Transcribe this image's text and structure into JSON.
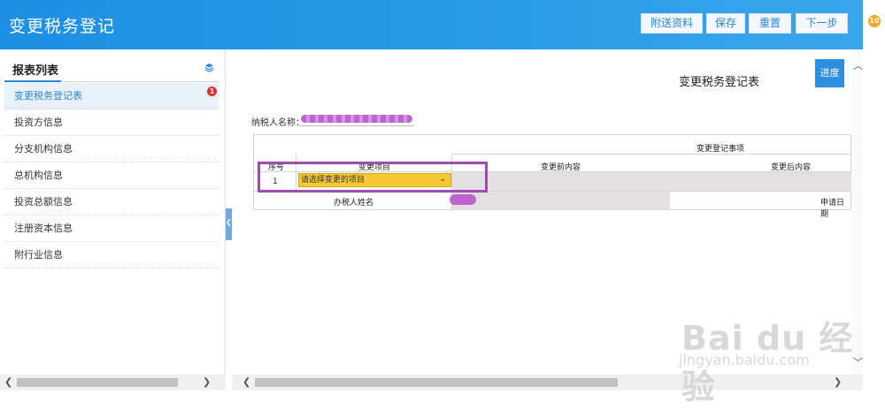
{
  "header": {
    "title": "变更税务登记",
    "buttons": {
      "attach": "附送资料",
      "save": "保存",
      "reset": "重置",
      "next": "下一步"
    },
    "notification_count": "10"
  },
  "sidebar": {
    "title": "报表列表",
    "items": [
      {
        "label": "变更税务登记表",
        "badge": "1"
      },
      {
        "label": "投资方信息"
      },
      {
        "label": "分支机构信息"
      },
      {
        "label": "总机构信息"
      },
      {
        "label": "投资总额信息"
      },
      {
        "label": "注册资本信息"
      },
      {
        "label": "附行业信息"
      }
    ]
  },
  "form": {
    "title": "变更税务登记表",
    "progress_label": "进度",
    "taxpayer_label": "纳税人名称：",
    "table": {
      "group_header": "变更登记事项",
      "col_seq": "序号",
      "col_item": "变更项目",
      "col_before": "变更前内容",
      "col_after": "变更后内容",
      "row_seq": "1",
      "select_value": "请选择变更的项目",
      "agent_label": "办税人姓名",
      "apply_date_label": "申请日期"
    }
  },
  "watermark": {
    "brand": "Bai du 经验",
    "url": "jingyan.baidu.com"
  },
  "colors": {
    "header_blue": "#2a9be9",
    "accent": "#2a86d8",
    "select_fill": "#f7c832",
    "highlight_border": "#a04bb0",
    "badge_red": "#e2302a",
    "badge_orange": "#f5a623"
  }
}
